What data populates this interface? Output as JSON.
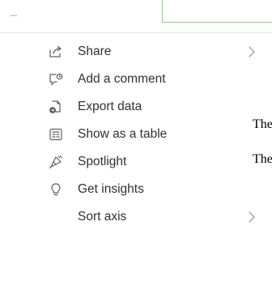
{
  "header": {
    "more_label": "..."
  },
  "menu": {
    "share": "Share",
    "add_comment": "Add a comment",
    "export_data": "Export data",
    "show_table": "Show as a table",
    "spotlight": "Spotlight",
    "get_insights": "Get insights",
    "sort_axis": "Sort axis"
  },
  "background": {
    "text_1": "The",
    "text_2": "The"
  },
  "colors": {
    "accent_border": "#8fce84",
    "text": "#323130",
    "icon": "#605e5c"
  },
  "icons": {
    "share": "share-icon",
    "add_comment": "comment-icon",
    "export_data": "export-icon",
    "show_table": "table-icon",
    "spotlight": "spotlight-icon",
    "get_insights": "lightbulb-icon",
    "chevron": "chevron-right-icon"
  }
}
